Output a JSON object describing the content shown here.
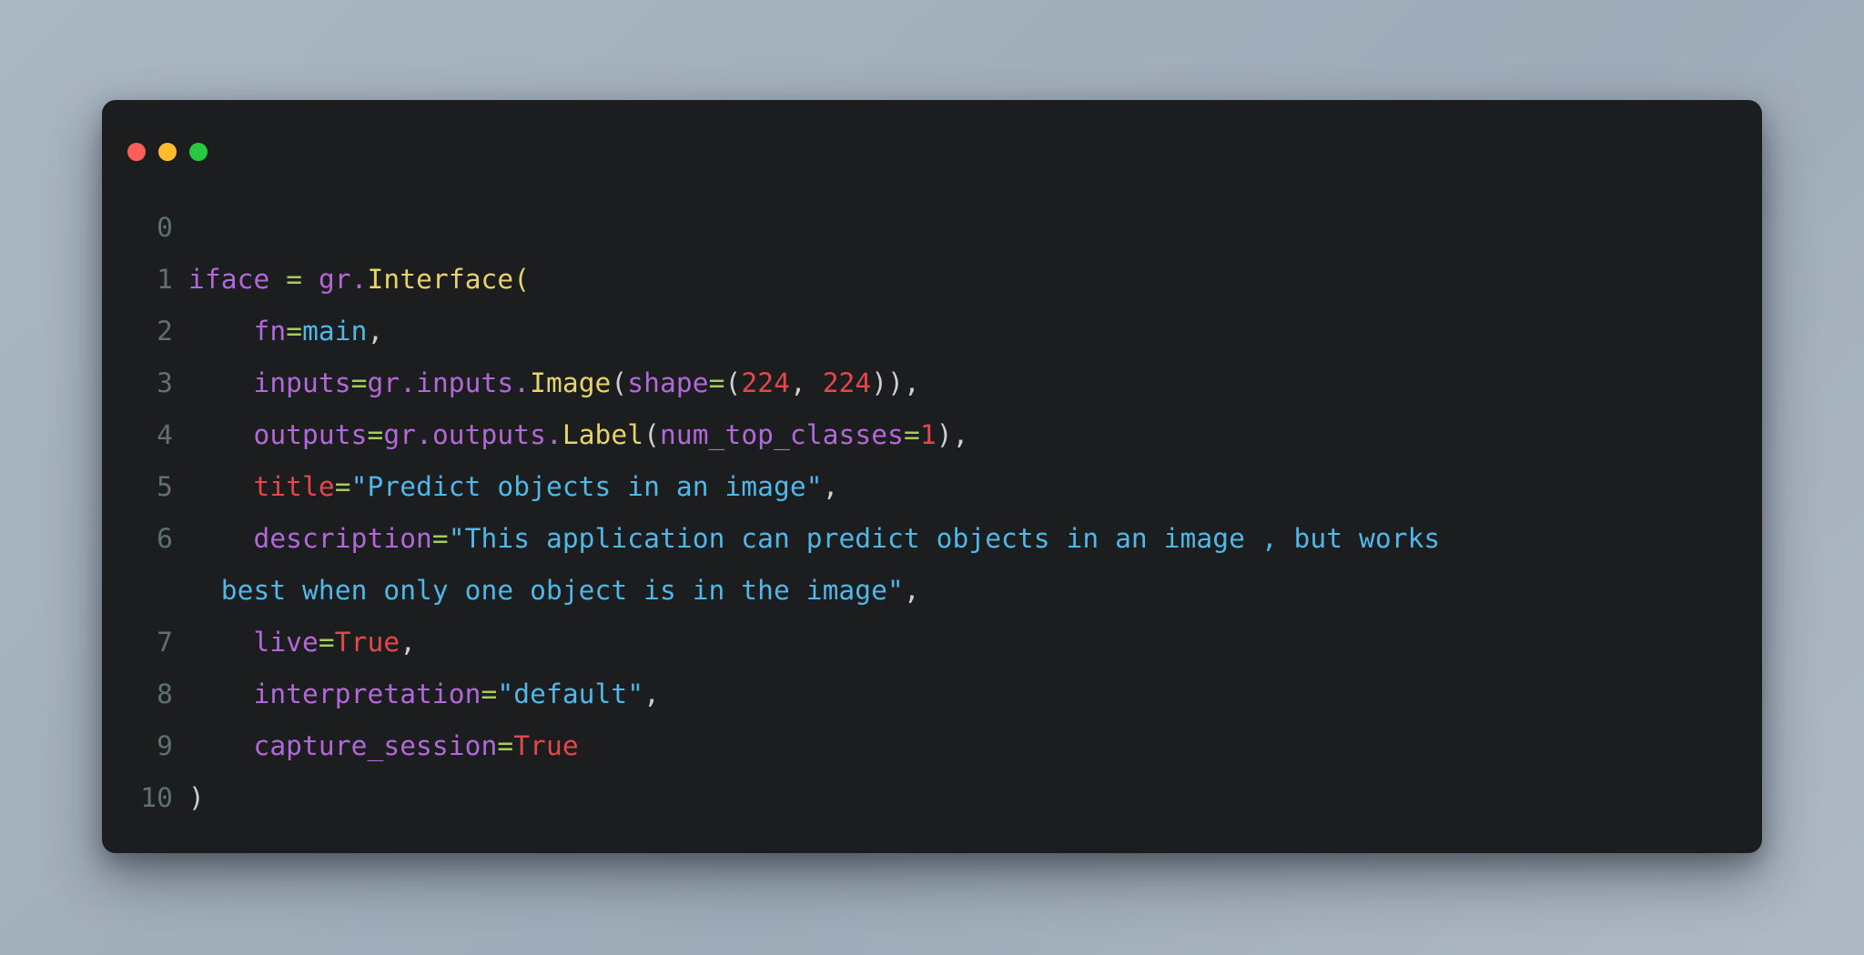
{
  "window": {
    "title_bar": {
      "dots": [
        {
          "name": "close-dot",
          "color": "#ff5f56"
        },
        {
          "name": "minimize-dot",
          "color": "#ffbd2e"
        },
        {
          "name": "maximize-dot",
          "color": "#27c93f"
        }
      ]
    },
    "background_color": "#1c1d1f",
    "page_background": "#a8b4c0"
  },
  "editor": {
    "language": "python",
    "theme_colors": {
      "line_number": "#5e7070",
      "variable": "#b368d9",
      "operator": "#a6cc5a",
      "class_name": "#e8d36a",
      "string": "#4fb8e8",
      "number": "#e3474a",
      "keyword": "#e3474a",
      "punctuation": "#cfcfcf"
    },
    "lines": [
      {
        "number": "0",
        "text": ""
      },
      {
        "number": "1",
        "text": "iface = gr.Interface("
      },
      {
        "number": "2",
        "text": "    fn=main,"
      },
      {
        "number": "3",
        "text": "    inputs=gr.inputs.Image(shape=(224, 224)),"
      },
      {
        "number": "4",
        "text": "    outputs=gr.outputs.Label(num_top_classes=1),"
      },
      {
        "number": "5",
        "text": "    title=\"Predict objects in an image\","
      },
      {
        "number": "6",
        "text": "    description=\"This application can predict objects in an image , but works"
      },
      {
        "number": "",
        "text": "  best when only one object is in the image\","
      },
      {
        "number": "7",
        "text": "    live=True,"
      },
      {
        "number": "8",
        "text": "    interpretation=\"default\","
      },
      {
        "number": "9",
        "text": "    capture_session=True"
      },
      {
        "number": "10",
        "text": ")"
      }
    ],
    "tokens": {
      "line1": {
        "var": "iface",
        "eq": "=",
        "module": "gr.",
        "cls": "Interface",
        "open": "("
      },
      "line2": {
        "attr": "fn",
        "eq": "=",
        "val": "main",
        "comma": ","
      },
      "line3": {
        "attr": "inputs",
        "eq": "=",
        "module": "gr.inputs.",
        "cls": "Image",
        "open": "(",
        "kw": "shape",
        "eq2": "=",
        "num1": "224",
        "num2": "224",
        "close": ")),"
      },
      "line4": {
        "attr": "outputs",
        "eq": "=",
        "module": "gr.outputs.",
        "cls": "Label",
        "open": "(",
        "kw": "num_top_classes",
        "eq2": "=",
        "num": "1",
        "close": "),"
      },
      "line5": {
        "attr": "title",
        "eq": "=",
        "str": "\"Predict objects in an image\"",
        "comma": ","
      },
      "line6": {
        "attr": "description",
        "eq": "=",
        "str_part1": "\"This application can predict objects in an image , but works",
        "str_part2": "best when only one object is in the image\"",
        "comma": ","
      },
      "line7": {
        "attr": "live",
        "eq": "=",
        "kw": "True",
        "comma": ","
      },
      "line8": {
        "attr": "interpretation",
        "eq": "=",
        "str": "\"default\"",
        "comma": ","
      },
      "line9": {
        "attr": "capture_session",
        "eq": "=",
        "kw": "True"
      },
      "line10": {
        "close": ")"
      }
    }
  }
}
